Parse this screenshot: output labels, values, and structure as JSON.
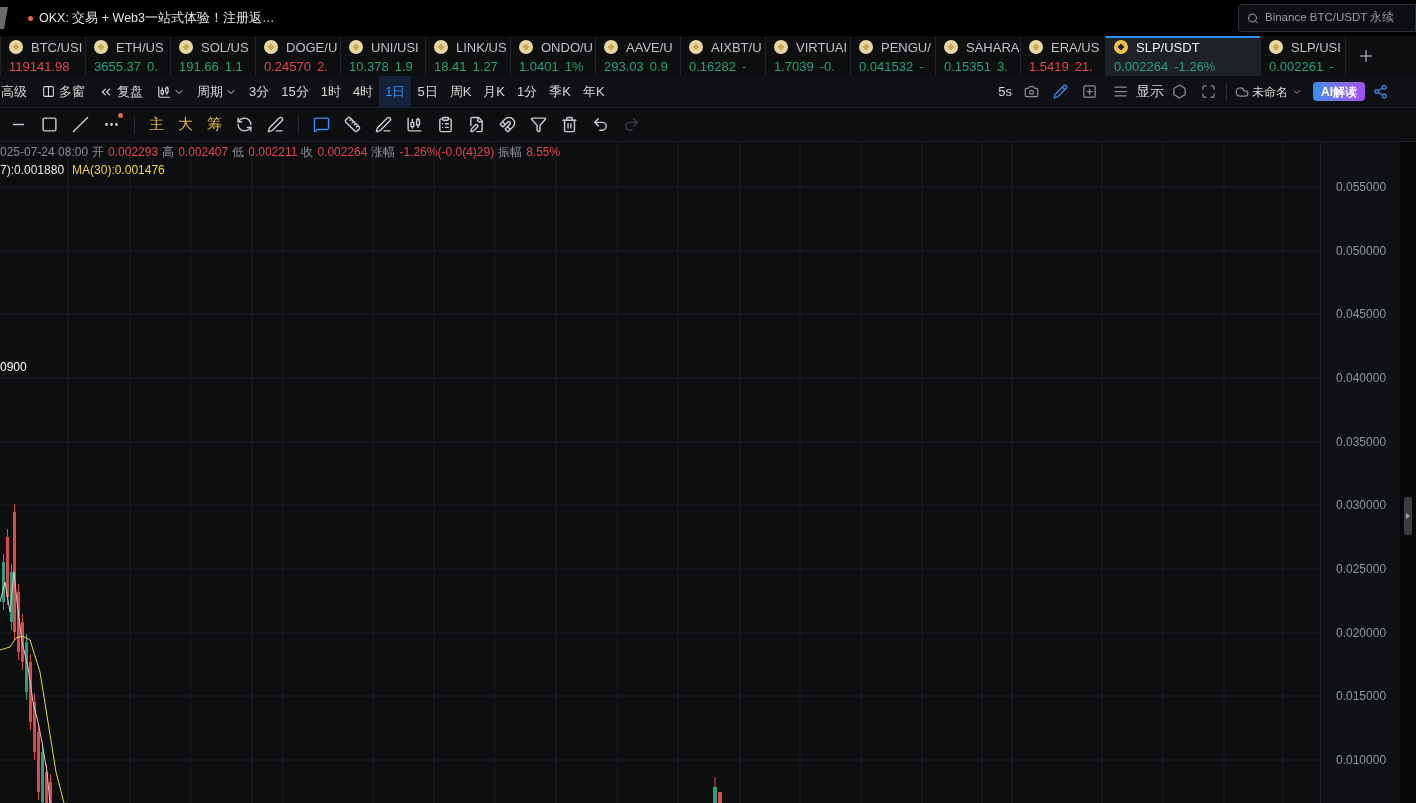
{
  "browser_tab": {
    "title": "OKX:  交易 + Web3一站式体验！注册返…",
    "unread": true
  },
  "search": {
    "placeholder": "Binance BTC/USDT 永续"
  },
  "tickers": [
    {
      "symbol": "BTC/USI",
      "price": "119141.98",
      "rising": false,
      "selected": false
    },
    {
      "symbol": "ETH/US",
      "price": "3655.37",
      "change": "0.",
      "rising": true,
      "selected": false
    },
    {
      "symbol": "SOL/US",
      "price": "191.66",
      "change": "1.1",
      "rising": true,
      "selected": false
    },
    {
      "symbol": "DOGE/U",
      "price": "0.24570",
      "change": "2.",
      "rising": false,
      "selected": false
    },
    {
      "symbol": "UNI/USI",
      "price": "10.378",
      "change": "1.9",
      "rising": true,
      "selected": false
    },
    {
      "symbol": "LINK/US",
      "price": "18.41",
      "change": "1.27",
      "rising": true,
      "selected": false
    },
    {
      "symbol": "ONDO/U",
      "price": "1.0401",
      "change": "1%",
      "rising": true,
      "selected": false
    },
    {
      "symbol": "AAVE/U",
      "price": "293.03",
      "change": "0.9",
      "rising": true,
      "selected": false
    },
    {
      "symbol": "AIXBT/U",
      "price": "0.16282",
      "change": "-",
      "rising": true,
      "selected": false
    },
    {
      "symbol": "VIRTUAI",
      "price": "1.7039",
      "change": "-0.",
      "rising": true,
      "selected": false
    },
    {
      "symbol": "PENGU/",
      "price": "0.041532",
      "change": "-",
      "rising": true,
      "selected": false
    },
    {
      "symbol": "SAHARA",
      "price": "0.15351",
      "change": "3.",
      "rising": true,
      "selected": false
    },
    {
      "symbol": "ERA/US",
      "price": "1.5419",
      "change": "21.",
      "rising": false,
      "selected": false
    },
    {
      "symbol": "SLP/USDT",
      "price": "0.002264",
      "change": "-1.26%",
      "rising": true,
      "selected": true
    },
    {
      "symbol": "SLP/USI",
      "price": "0.002261",
      "change": "-",
      "rising": true,
      "selected": false
    }
  ],
  "tools": [
    "高级",
    "多窗",
    "复盘"
  ],
  "period_menu": "周期",
  "periods": [
    {
      "label": "3分",
      "selected": false
    },
    {
      "label": "15分",
      "selected": false
    },
    {
      "label": "1时",
      "selected": false
    },
    {
      "label": "4时",
      "selected": false
    },
    {
      "label": "1日",
      "selected": true
    },
    {
      "label": "5日",
      "selected": false
    },
    {
      "label": "周K",
      "selected": false
    },
    {
      "label": "月K",
      "selected": false
    },
    {
      "label": "1分",
      "selected": false
    },
    {
      "label": "季K",
      "selected": false
    },
    {
      "label": "年K",
      "selected": false
    }
  ],
  "refresh_interval": "5s",
  "drawing_mode": true,
  "display_menu": "显示",
  "layout_name": "未命名",
  "ai_button": "AI解读",
  "more_tools_notice": true,
  "indicator_shortcuts": [
    "主",
    "大",
    "筹"
  ],
  "redo": {
    "disabled": true
  },
  "ohlc": {
    "date": "025-07-24 08:00",
    "fields": [
      {
        "label": "开",
        "value": "0.002293"
      },
      {
        "label": "高",
        "value": "0.002407"
      },
      {
        "label": "低",
        "value": "0.002211"
      },
      {
        "label": "收",
        "value": "0.002264"
      },
      {
        "label": "涨幅",
        "value": "-1.26%(-0.0(4)29)"
      },
      {
        "label": "振幅",
        "value": "8.55%"
      }
    ]
  },
  "moving_averages": [
    {
      "label": "7):0.001880",
      "color": "#e8e8e8"
    },
    {
      "label": "MA(30):0.001476",
      "color": "#f0d43a"
    }
  ],
  "price_marker": "0900",
  "price_axis": [
    "0.055000",
    "0.050000",
    "0.045000",
    "0.040000",
    "0.035000",
    "0.030000",
    "0.025000",
    "0.020000",
    "0.015000",
    "0.010000"
  ]
}
